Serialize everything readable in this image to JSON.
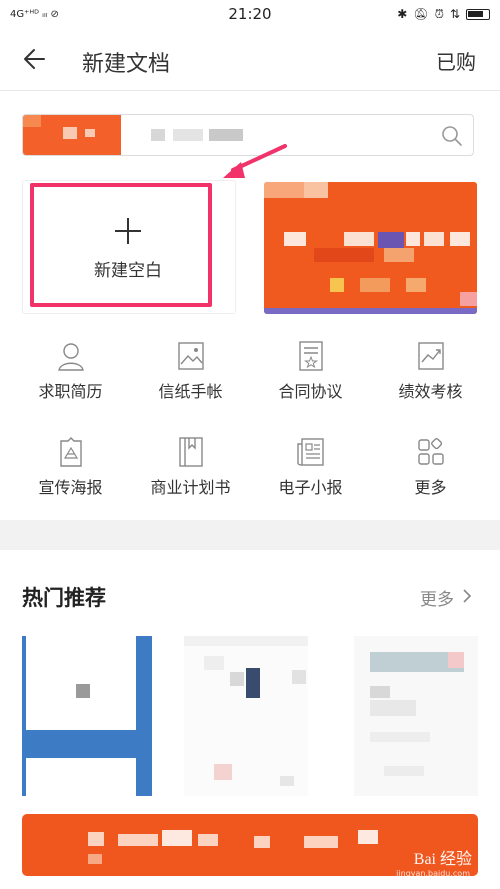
{
  "status_bar": {
    "left": "4G⁺ᴴᴰ ᵢₗₗ ⊘",
    "time": "21:20",
    "right_icons": [
      "bluetooth-icon",
      "silent-icon",
      "alarm-icon",
      "data-icon",
      "battery-icon"
    ]
  },
  "header": {
    "title": "新建文档",
    "purchased_label": "已购"
  },
  "templates": {
    "blank_label": "新建空白"
  },
  "categories": [
    {
      "label": "求职简历",
      "icon": "resume-icon"
    },
    {
      "label": "信纸手帐",
      "icon": "letter-icon"
    },
    {
      "label": "合同协议",
      "icon": "contract-icon"
    },
    {
      "label": "绩效考核",
      "icon": "performance-icon"
    },
    {
      "label": "宣传海报",
      "icon": "poster-icon"
    },
    {
      "label": "商业计划书",
      "icon": "business-plan-icon"
    },
    {
      "label": "电子小报",
      "icon": "newsletter-icon"
    },
    {
      "label": "更多",
      "icon": "grid-more-icon"
    }
  ],
  "hot": {
    "title": "热门推荐",
    "more_label": "更多"
  },
  "watermark": {
    "text": "Bai 经验",
    "sub": "jingyan.baidu.com"
  },
  "colors": {
    "accent": "#f05a1e",
    "highlight": "#f1336a"
  }
}
